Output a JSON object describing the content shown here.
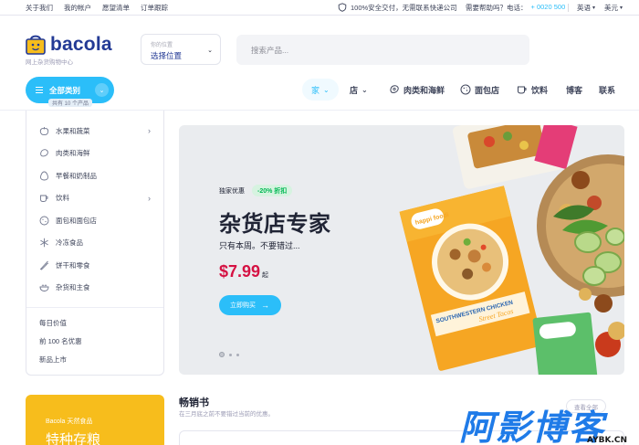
{
  "topbar": {
    "links": [
      "关于我们",
      "我的帐户",
      "愿望清单",
      "订单跟踪"
    ],
    "secure_text": "100%安全交付，无需联系快递公司",
    "help_label": "需要帮助吗？电话：",
    "phone": "+ 0020 500",
    "language": "英语",
    "currency": "美元"
  },
  "brand": {
    "name": "bacola",
    "tagline": "网上杂货购物中心",
    "accent": "#2bbef9",
    "brand_blue": "#233a95",
    "price_red": "#d51243"
  },
  "location": {
    "label": "你的位置",
    "value": "选择位置"
  },
  "search": {
    "placeholder": "搜索产品..."
  },
  "all_categories": {
    "label": "全部类别",
    "count": "共有 10 个产品"
  },
  "nav": {
    "home": "家",
    "shop": "店",
    "meat": "肉类和海鲜",
    "bakery": "面包店",
    "drinks": "饮料",
    "blog": "博客",
    "contact": "联系"
  },
  "sidebar": {
    "categories": [
      {
        "label": "水果和蔬菜",
        "icon": "apple-icon",
        "has_sub": true
      },
      {
        "label": "肉类和海鲜",
        "icon": "meat-icon",
        "has_sub": false
      },
      {
        "label": "早餐和奶制品",
        "icon": "egg-icon",
        "has_sub": false
      },
      {
        "label": "饮料",
        "icon": "cup-icon",
        "has_sub": true
      },
      {
        "label": "面包和面包店",
        "icon": "cookie-icon",
        "has_sub": false
      },
      {
        "label": "冷冻食品",
        "icon": "snowflake-icon",
        "has_sub": false
      },
      {
        "label": "饼干和零食",
        "icon": "carrot-icon",
        "has_sub": false
      },
      {
        "label": "杂货和主食",
        "icon": "bowl-icon",
        "has_sub": false
      }
    ],
    "extra_links": [
      "每日价值",
      "前 100 名优惠",
      "新品上市"
    ]
  },
  "hero": {
    "exclusive": "独家优惠",
    "discount": "-20% 折扣",
    "title": "杂货店专家",
    "subtitle": "只有本周。不要错过...",
    "price": "$7.99",
    "price_suffix": "起",
    "button": "立即购买",
    "package_brand": "happi foodi",
    "package_name": "SOUTHWESTERN CHICKEN",
    "package_tagline": "Street Tacos"
  },
  "promo": {
    "line1": "Bacola 天然食品",
    "line2": "特种存粮"
  },
  "bestsellers": {
    "title": "畅销书",
    "subtitle": "在三月底之前不要错过当前的优惠。",
    "view_all": "查看全部"
  },
  "watermark": {
    "text": "阿影博客",
    "url": "AYBK.CN"
  }
}
